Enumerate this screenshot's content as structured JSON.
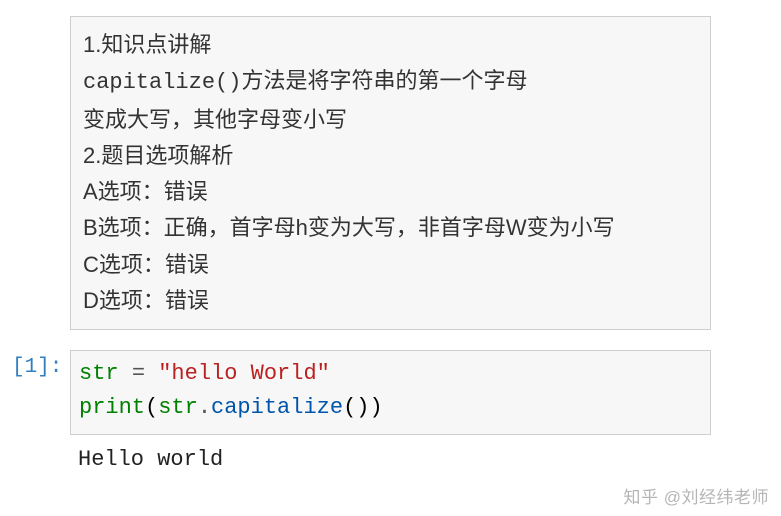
{
  "markdown": {
    "line1_prefix": "1.知识点讲解",
    "line2_code": "capitalize()",
    "line2_rest": "方法是将字符串的第一个字母",
    "line3": "变成大写，其他字母变小写",
    "line4": "2.题目选项解析",
    "line5": "A选项：错误",
    "line6": "B选项：正确，首字母h变为大写，非首字母W变为小写",
    "line7": "C选项：错误",
    "line8": "D选项：错误"
  },
  "code": {
    "prompt": "[1]:",
    "l1_var": "str",
    "l1_sp1": " ",
    "l1_eq": "=",
    "l1_sp2": " ",
    "l1_str": "\"hello World\"",
    "l2_print": "print",
    "l2_open": "(",
    "l2_var": "str",
    "l2_dot": ".",
    "l2_method": "capitalize",
    "l2_close": "())"
  },
  "output": {
    "text": "Hello world"
  },
  "watermark": "知乎 @刘经纬老师"
}
